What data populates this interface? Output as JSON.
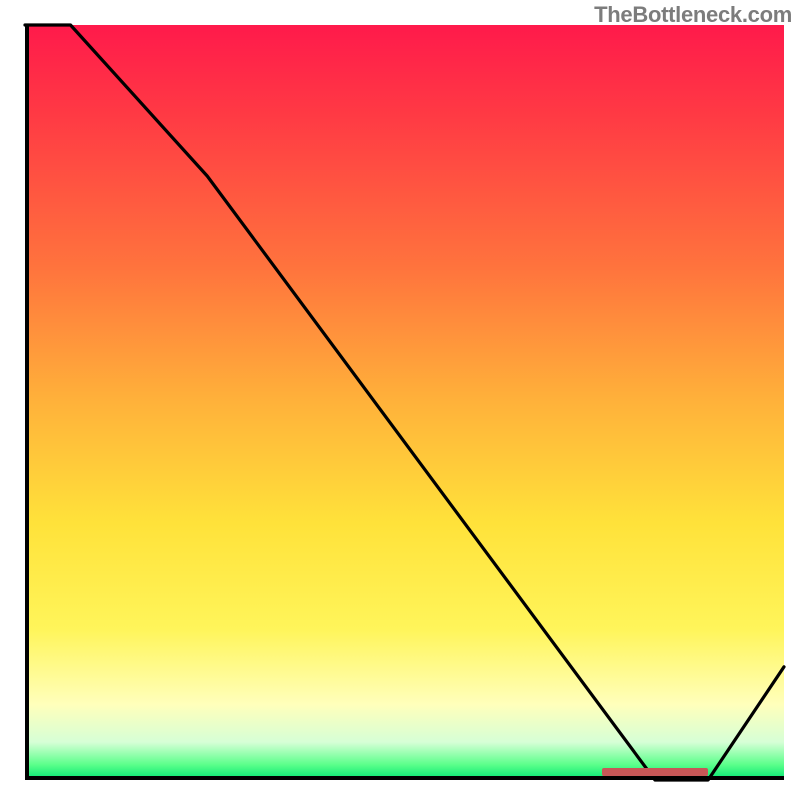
{
  "attribution": "TheBottleneck.com",
  "colors": {
    "grad_top": "#ff1a4b",
    "grad_bottom": "#00e672",
    "curve": "#000000",
    "axis": "#000000",
    "marker": "#c75757"
  },
  "chart_data": {
    "type": "line",
    "title": "",
    "xlabel": "",
    "ylabel": "",
    "xlim": [
      0,
      100
    ],
    "ylim": [
      0,
      100
    ],
    "x": [
      0,
      6,
      24,
      83,
      90,
      100
    ],
    "y": [
      100,
      100,
      80,
      0,
      0,
      15
    ],
    "annotations": [
      {
        "kind": "segment",
        "x0": 76,
        "x1": 90,
        "y": 1
      }
    ],
    "note": "Axes carry no visible tick labels; values are relative 0–100 estimates read from the plot geometry."
  }
}
